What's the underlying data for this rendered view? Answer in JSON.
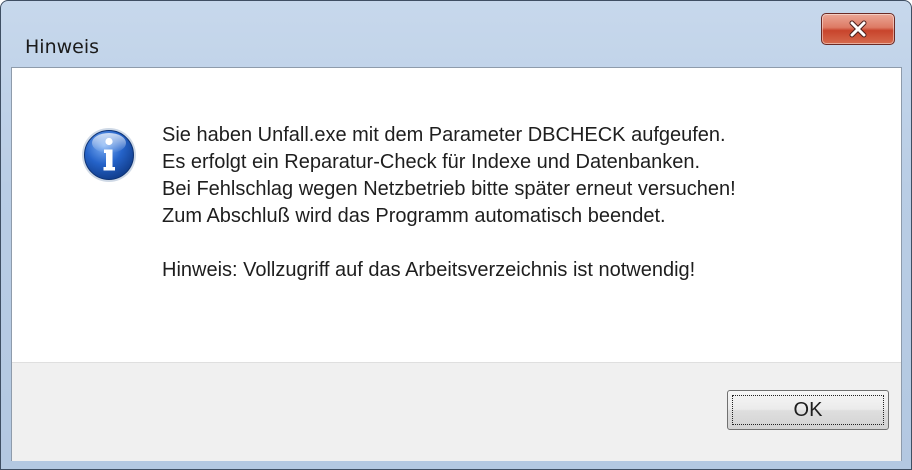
{
  "window": {
    "title": "Hinweis"
  },
  "titlebar": {
    "close_icon": "close-icon"
  },
  "message": {
    "icon": "info-icon",
    "lines": [
      "Sie haben Unfall.exe mit dem Parameter DBCHECK aufgeufen.",
      "Es erfolgt ein Reparatur-Check für Indexe und Datenbanken.",
      "Bei Fehlschlag wegen Netzbetrieb bitte später erneut versuchen!",
      "Zum Abschluß wird das Programm automatisch beendet."
    ],
    "note": "Hinweis: Vollzugriff auf das Arbeitsverzeichnis ist notwendig!"
  },
  "buttons": {
    "ok_label": "OK"
  },
  "colors": {
    "titlebar": "#b9cde5",
    "close_button": "#c8442c",
    "footer": "#f0f0f0",
    "info_icon": "#1c56b7"
  }
}
